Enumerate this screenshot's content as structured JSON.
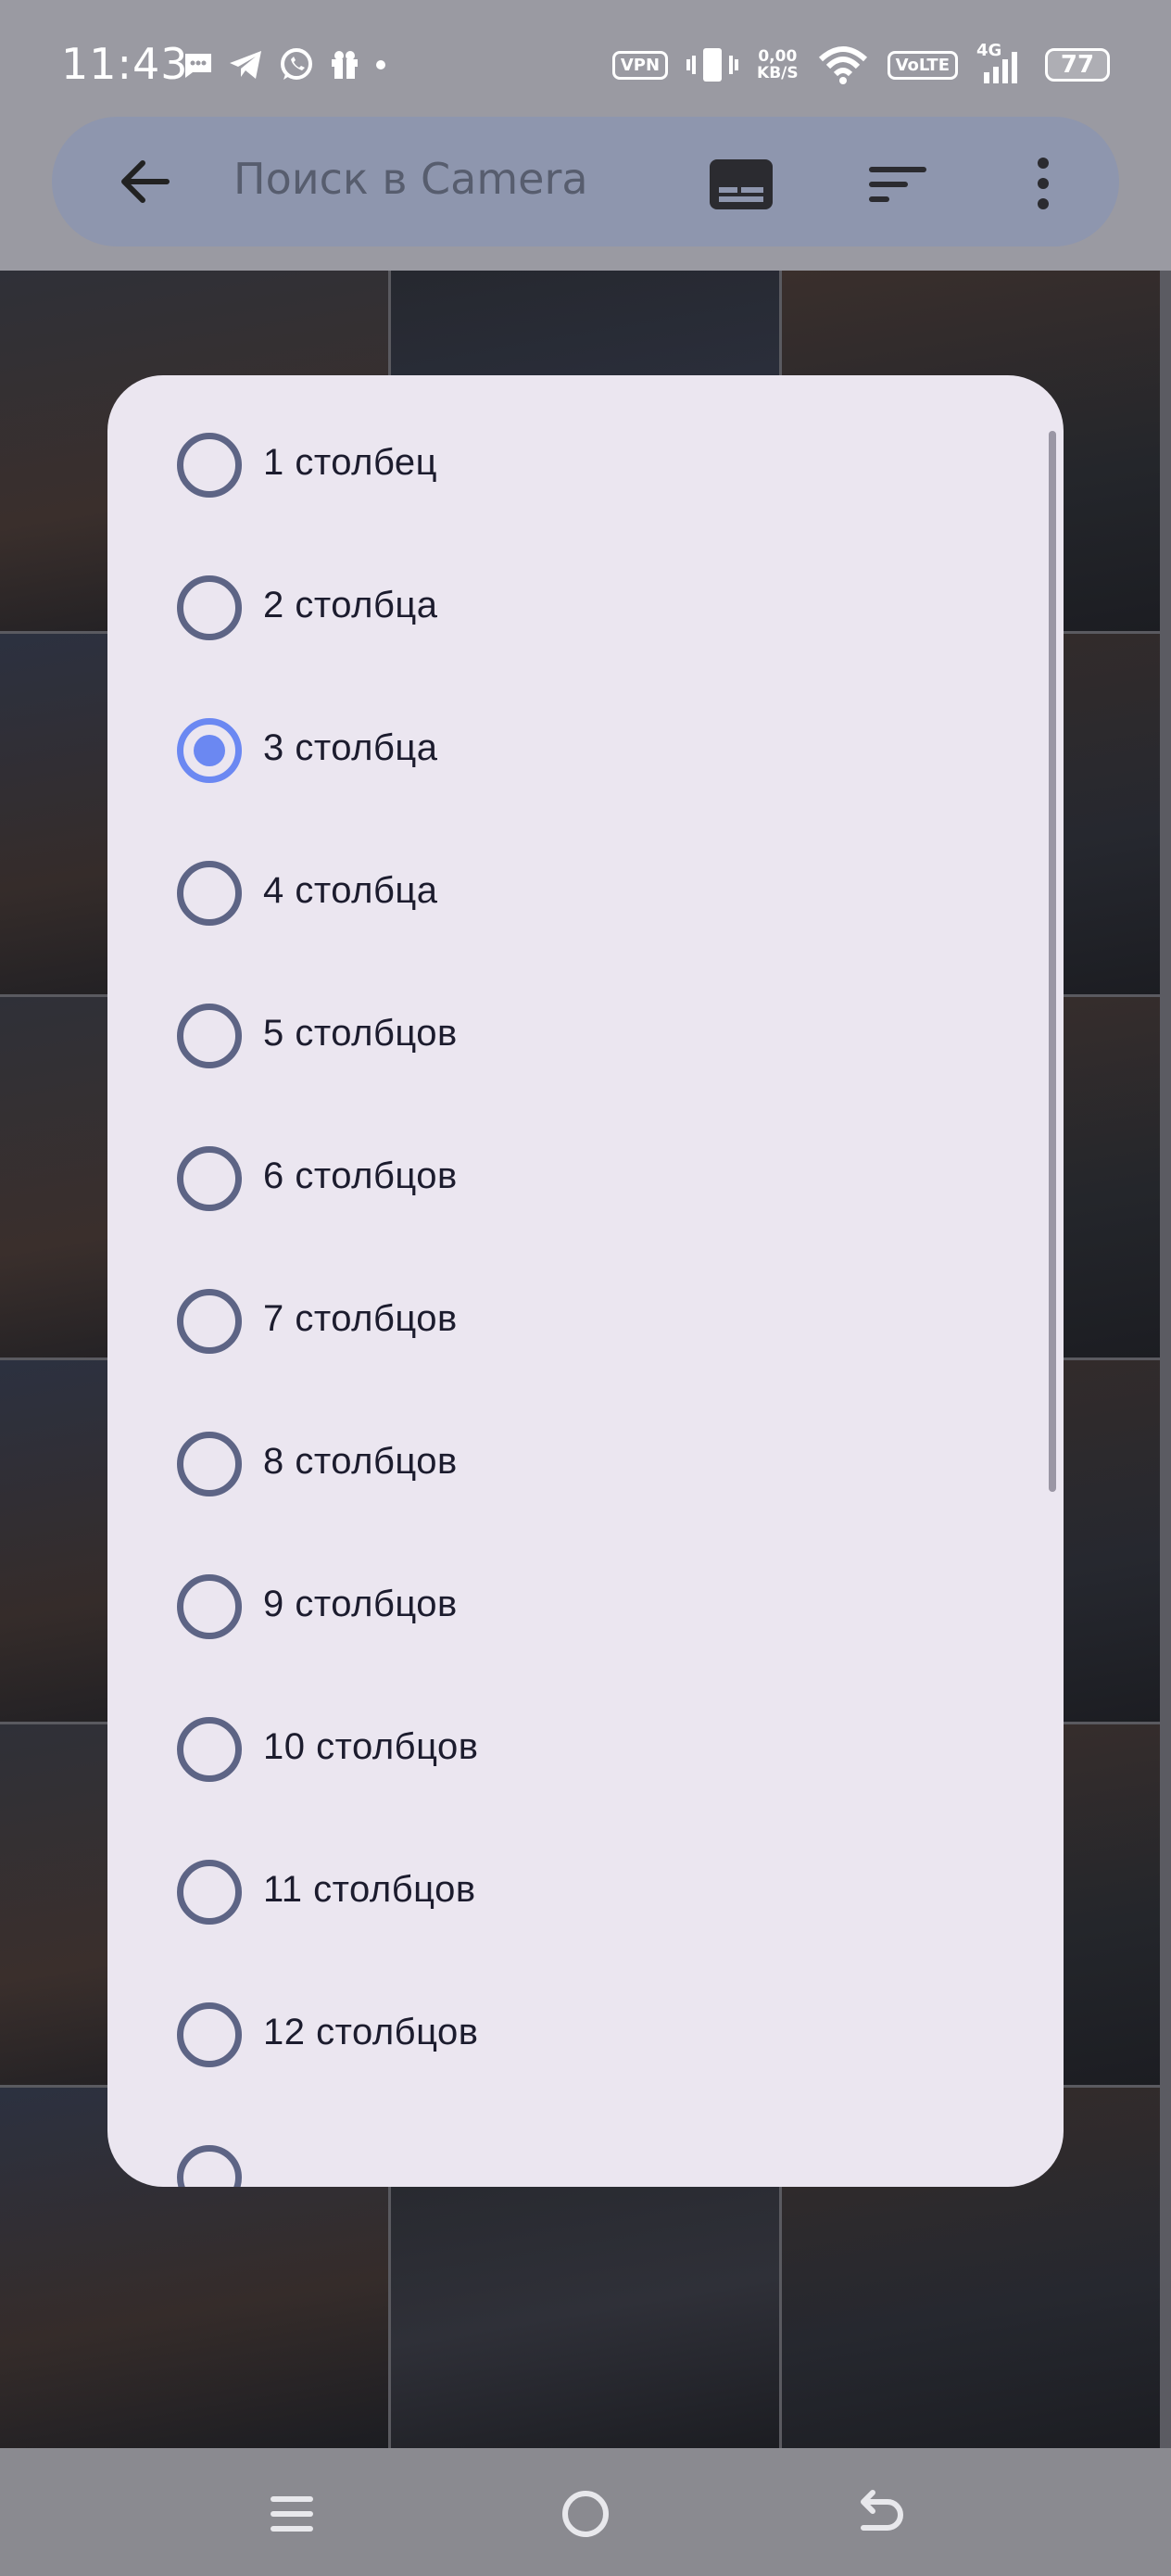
{
  "status_bar": {
    "time": "11:43",
    "left_icons": [
      "message-icon",
      "telegram-icon",
      "whatsapp-icon",
      "gift-icon",
      "dot-icon"
    ],
    "vpn": "VPN",
    "speed_value": "0,00",
    "speed_unit": "KB/S",
    "volte": "VoLTE",
    "network": "4G",
    "battery": "77"
  },
  "app_bar": {
    "search_placeholder": "Поиск в Camera",
    "icons": [
      "back-arrow-icon",
      "subtitles-icon",
      "sort-icon",
      "more-vert-icon"
    ]
  },
  "dialog": {
    "selected_index": 2,
    "options": [
      {
        "label": "1 столбец"
      },
      {
        "label": "2 столбца"
      },
      {
        "label": "3 столбца"
      },
      {
        "label": "4 столбца"
      },
      {
        "label": "5 столбцов"
      },
      {
        "label": "6 столбцов"
      },
      {
        "label": "7 столбцов"
      },
      {
        "label": "8 столбцов"
      },
      {
        "label": "9 столбцов"
      },
      {
        "label": "10 столбцов"
      },
      {
        "label": "11 столбцов"
      },
      {
        "label": "12 столбцов"
      },
      {
        "label": ""
      }
    ]
  },
  "grid": {
    "columns": 3,
    "tiles": 18
  },
  "nav_bar": {
    "icons": [
      "menu-icon",
      "home-circle-icon",
      "back-icon"
    ]
  },
  "colors": {
    "dialog_bg": "#ebe6f0",
    "radio_selected": "#6b88f2",
    "radio_unselected": "#5d6485",
    "search_bar": "#8e96ae"
  }
}
